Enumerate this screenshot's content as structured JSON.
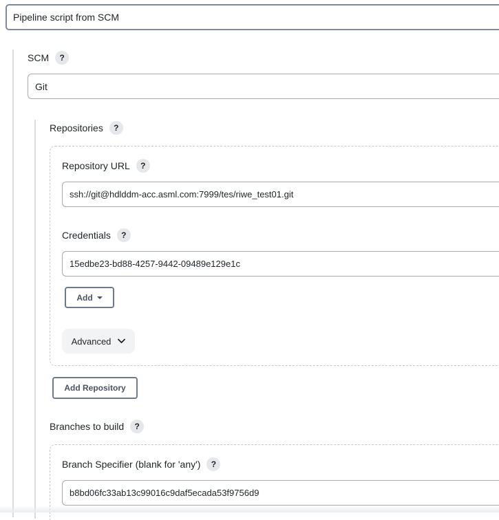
{
  "definition": {
    "selected": "Pipeline script from SCM"
  },
  "scm": {
    "label": "SCM",
    "help": "?",
    "selected": "Git"
  },
  "repositories": {
    "label": "Repositories",
    "help": "?",
    "repository_url": {
      "label": "Repository URL",
      "help": "?",
      "value": "ssh://git@hdlddm-acc.asml.com:7999/tes/riwe_test01.git"
    },
    "credentials": {
      "label": "Credentials",
      "help": "?",
      "selected": "15edbe23-bd88-4257-9442-09489e129e1c",
      "add_label": "Add"
    },
    "advanced_label": "Advanced",
    "add_repository_label": "Add Repository"
  },
  "branches": {
    "label": "Branches to build",
    "help": "?",
    "specifier": {
      "label": "Branch Specifier (blank for 'any')",
      "help": "?",
      "value": "b8bd06fc33ab13c99016c9daf5ecada53f9756d9"
    }
  }
}
